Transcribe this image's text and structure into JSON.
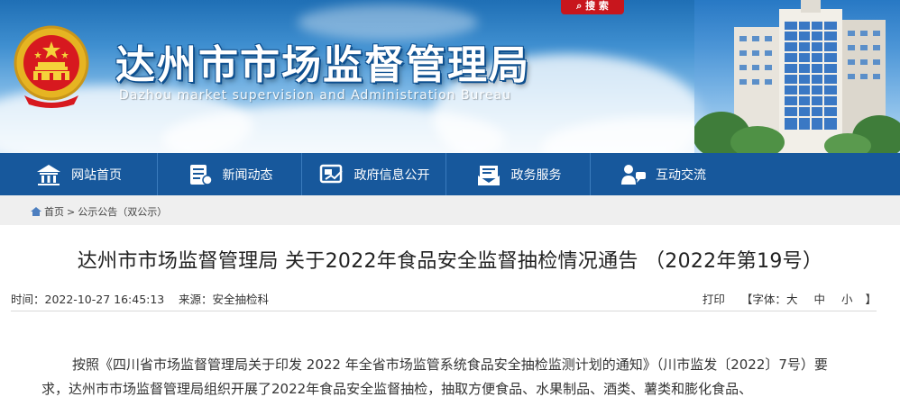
{
  "header": {
    "title_zh": "达州市市场监督管理局",
    "title_en": "Dazhou market supervision and Administration Bureau",
    "search_label": "搜 索"
  },
  "nav": {
    "items": [
      {
        "label": "网站首页",
        "icon": "home-icon"
      },
      {
        "label": "新闻动态",
        "icon": "news-icon"
      },
      {
        "label": "政府信息公开",
        "icon": "gov-info-icon"
      },
      {
        "label": "政务服务",
        "icon": "service-icon"
      },
      {
        "label": "互动交流",
        "icon": "interaction-icon"
      }
    ]
  },
  "breadcrumb": {
    "home": "首页",
    "separator": ">",
    "current": "公示公告（双公示）"
  },
  "article": {
    "title": "达州市市场监督管理局 关于2022年食品安全监督抽检情况通告 （2022年第19号）",
    "time": "时间：2022-10-27 16:45:13",
    "source": "来源：安全抽检科",
    "print_label": "打印",
    "font_prefix": "【字体：",
    "font_large": "大",
    "font_medium": "中",
    "font_small": "小",
    "font_suffix": "】",
    "paragraph": "按照《四川省市场监督管理局关于印发 2022 年全省市场监管系统食品安全抽检监测计划的通知》（川市监发〔2022〕7号）要求，达州市市场监督管理局组织开展了2022年食品安全监督抽检，抽取方便食品、水果制品、酒类、薯类和膨化食品、"
  },
  "colors": {
    "nav_bg": "#17589c",
    "search_bg": "#c8161d",
    "crumb_bg": "#efefef"
  }
}
